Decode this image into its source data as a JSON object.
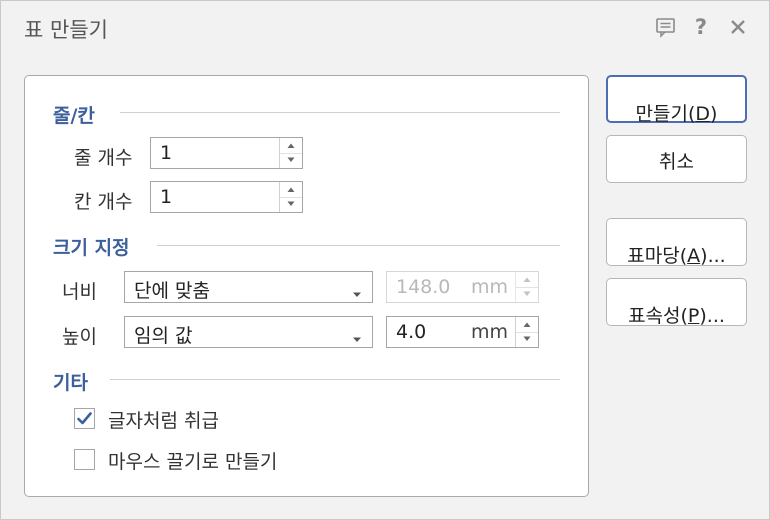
{
  "dialog": {
    "title": "표 만들기",
    "title_icons": [
      "comment-icon",
      "help-icon",
      "close-icon"
    ],
    "help_glyph": "?"
  },
  "sections": {
    "row_col": {
      "title": "줄/칸",
      "rows_label": "줄 개수",
      "rows_value": "1",
      "cols_label": "칸 개수",
      "cols_value": "1"
    },
    "size": {
      "title": "크기 지정",
      "width_label": "너비",
      "width_mode": "단에 맞춤",
      "width_value": "148.0",
      "width_unit": "mm",
      "height_label": "높이",
      "height_mode": "임의 값",
      "height_value": "4.0",
      "height_unit": "mm"
    },
    "other": {
      "title": "기타",
      "treat_as_char_label": "글자처럼 취급",
      "treat_as_char_checked": true,
      "mouse_drag_label": "마우스 끌기로 만들기",
      "mouse_drag_checked": false
    }
  },
  "buttons": {
    "create_pre": "만들기(",
    "create_key": "D",
    "create_post": ")",
    "cancel": "취소",
    "table_cell_pre": "표마당(",
    "table_cell_key": "A",
    "table_cell_post": ")...",
    "table_props_pre": "표속성(",
    "table_props_key": "P",
    "table_props_post": ")..."
  },
  "colors": {
    "accent": "#3d5f9c",
    "primary_border": "#4b6db5",
    "check": "#3d5f9c"
  }
}
